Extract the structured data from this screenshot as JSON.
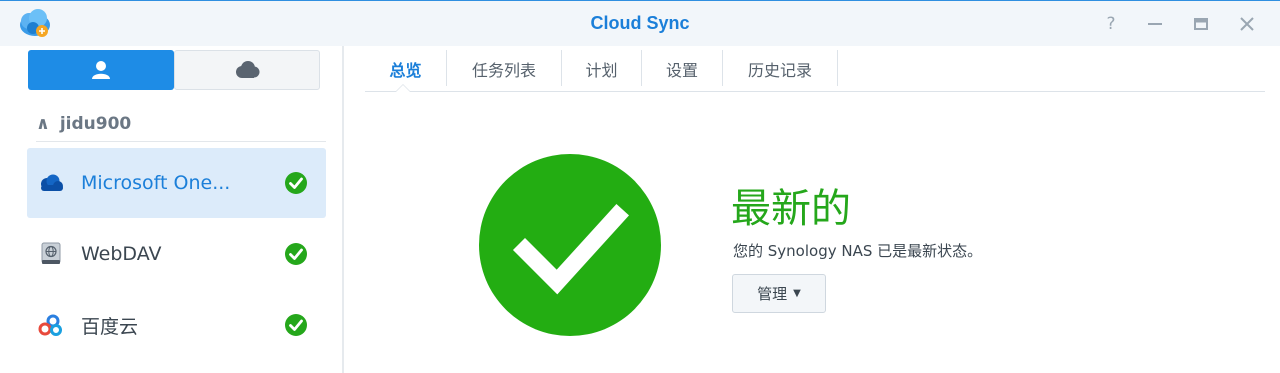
{
  "window": {
    "title": "Cloud Sync",
    "help_glyph": "?",
    "minimize_glyph": "—",
    "maximize_glyph": "□",
    "close_glyph": "✕"
  },
  "sidebar": {
    "mode_toggle": [
      {
        "icon": "user-icon",
        "active": true
      },
      {
        "icon": "cloud-icon",
        "active": false
      }
    ],
    "account": {
      "expand_glyph": "∧",
      "name": "jidu900"
    },
    "connections": [
      {
        "label": "Microsoft One...",
        "icon": "onedrive-icon",
        "status": "ok",
        "selected": true
      },
      {
        "label": "WebDAV",
        "icon": "webdav-icon",
        "status": "ok",
        "selected": false
      },
      {
        "label": "百度云",
        "icon": "baidu-cloud-icon",
        "status": "ok",
        "selected": false
      }
    ]
  },
  "tabs": [
    {
      "label": "总览",
      "active": true
    },
    {
      "label": "任务列表",
      "active": false
    },
    {
      "label": "计划",
      "active": false
    },
    {
      "label": "设置",
      "active": false
    },
    {
      "label": "历史记录",
      "active": false
    }
  ],
  "overview": {
    "status_title": "最新的",
    "status_description": "您的 Synology NAS 已是最新状态。",
    "manage_button": "管理",
    "manage_caret": "▼"
  },
  "colors": {
    "accent": "#1b7fd9",
    "success": "#25a71b",
    "selected_row": "#dcebfa"
  }
}
